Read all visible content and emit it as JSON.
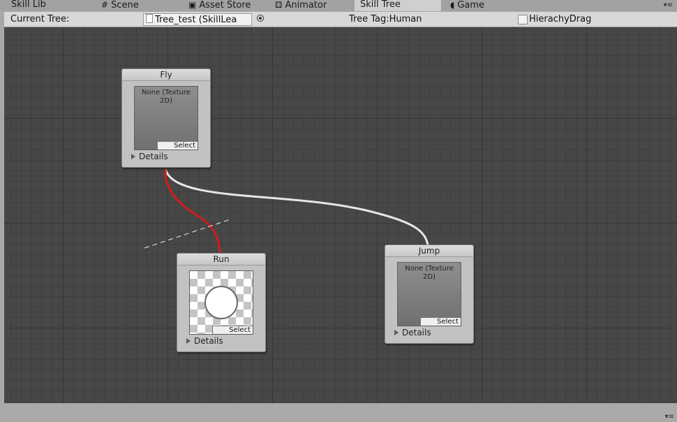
{
  "tabs": [
    {
      "label": "Skill Lib",
      "icon": "",
      "active": false
    },
    {
      "label": "Scene",
      "icon": "grid-icon",
      "active": false
    },
    {
      "label": "Asset Store",
      "icon": "store-icon",
      "active": false
    },
    {
      "label": "Animator",
      "icon": "animator-icon",
      "active": false
    },
    {
      "label": "Skill Tree",
      "icon": "",
      "active": true
    },
    {
      "label": "Game",
      "icon": "game-icon",
      "active": false
    }
  ],
  "toolbar": {
    "current_tree_label": "Current Tree:",
    "tree_field_value": "Tree_test (SkillLea",
    "tree_tag": "Tree Tag:Human",
    "hierarchy_drag_label": "HierachyDrag",
    "hierarchy_drag_checked": false
  },
  "nodes": {
    "fly": {
      "title": "Fly",
      "texture_text": "None (Texture 2D)",
      "select_label": "Select",
      "details_label": "Details"
    },
    "run": {
      "title": "Run",
      "select_label": "Select",
      "details_label": "Details"
    },
    "jump": {
      "title": "Jump",
      "texture_text": "None (Texture 2D)",
      "select_label": "Select",
      "details_label": "Details"
    }
  },
  "colors": {
    "canvas_bg": "#474747",
    "connection_selected": "#d21c1c",
    "connection_normal": "#e6e6e6",
    "drag_line": "#eeeeee"
  }
}
